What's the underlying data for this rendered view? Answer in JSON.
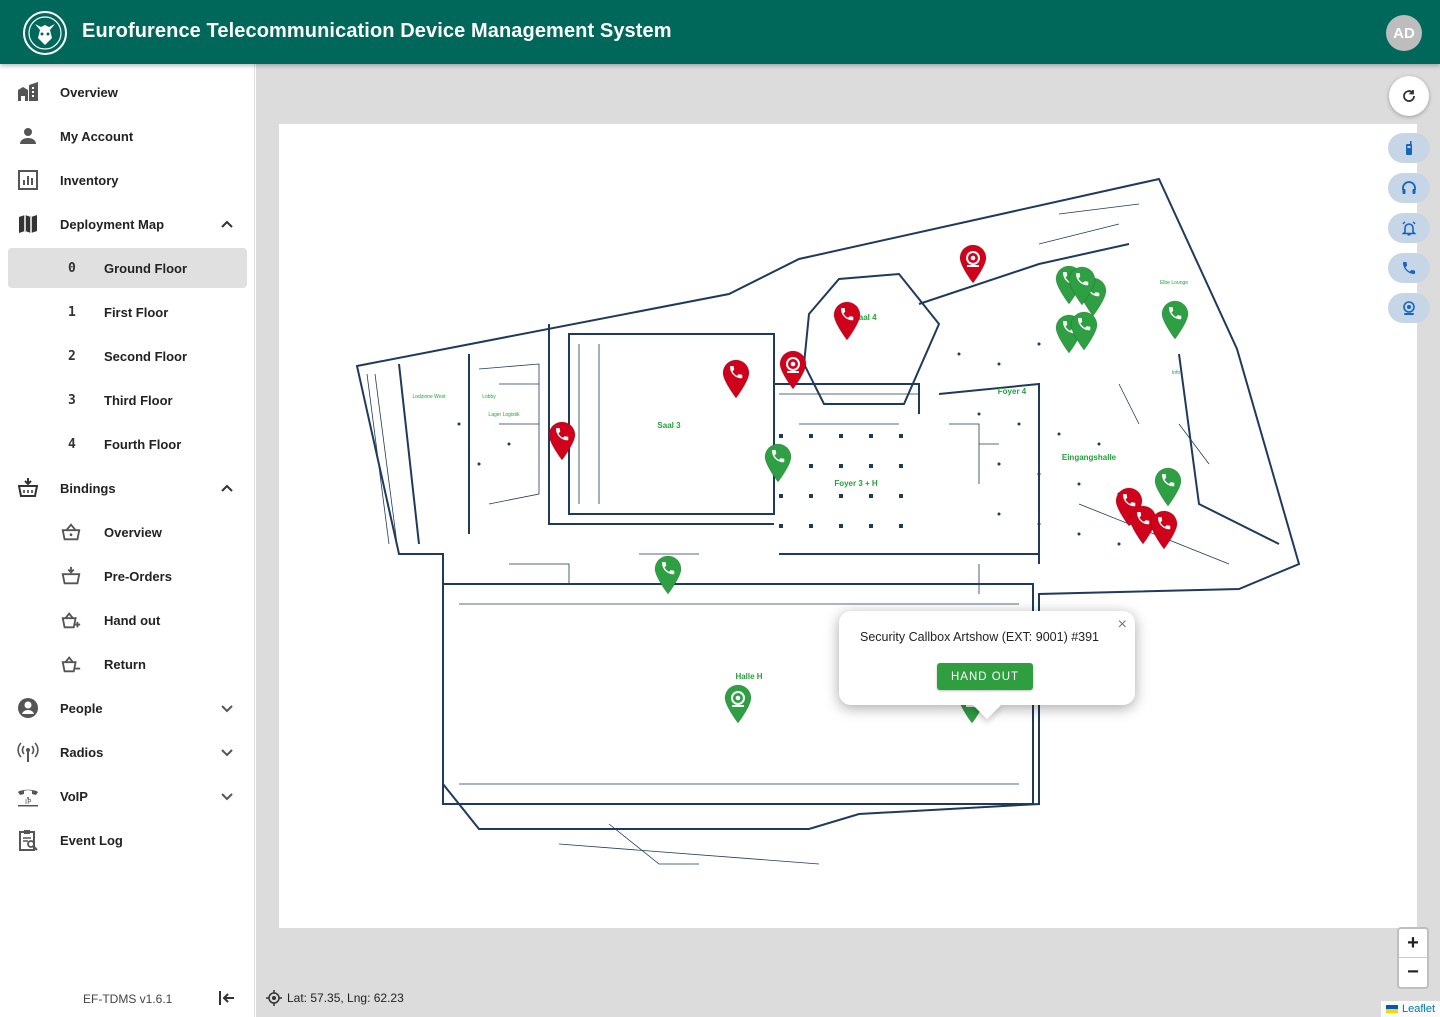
{
  "app": {
    "title": "Eurofurence Telecommunication Device Management System",
    "avatar_initials": "AD",
    "version": "EF-TDMS v1.6.1",
    "brand_color": "#00675b"
  },
  "sidebar": {
    "items": [
      {
        "label": "Overview",
        "icon": "building-icon"
      },
      {
        "label": "My Account",
        "icon": "person-icon"
      },
      {
        "label": "Inventory",
        "icon": "chart-box-icon"
      },
      {
        "label": "Deployment Map",
        "icon": "map-icon",
        "expanded": true
      },
      {
        "label": "Bindings",
        "icon": "basket-icon",
        "expanded": true
      },
      {
        "label": "People",
        "icon": "account-circle-icon",
        "expanded": false
      },
      {
        "label": "Radios",
        "icon": "radio-tower-icon",
        "expanded": false
      },
      {
        "label": "VoIP",
        "icon": "ip-phone-icon",
        "expanded": false
      },
      {
        "label": "Event Log",
        "icon": "clipboard-search-icon"
      }
    ],
    "floors": [
      {
        "num": "0",
        "label": "Ground Floor",
        "active": true
      },
      {
        "num": "1",
        "label": "First Floor"
      },
      {
        "num": "2",
        "label": "Second Floor"
      },
      {
        "num": "3",
        "label": "Third Floor"
      },
      {
        "num": "4",
        "label": "Fourth Floor"
      }
    ],
    "bindings": [
      {
        "label": "Overview",
        "icon": "basket-icon"
      },
      {
        "label": "Pre-Orders",
        "icon": "basket-down-icon"
      },
      {
        "label": "Hand out",
        "icon": "basket-plus-icon"
      },
      {
        "label": "Return",
        "icon": "basket-minus-icon"
      }
    ]
  },
  "map": {
    "status_colors": {
      "available": "#2ea043",
      "handed_out": "#d0021b"
    },
    "room_labels": [
      "Saal 4",
      "Foyer 4",
      "Saal 3",
      "Foyer 3 + H",
      "Eingangshalle",
      "Halle H",
      "Lobby",
      "Lager Logistik",
      "Lodzione West",
      "Elbe Lounge",
      "Info"
    ],
    "markers": [
      {
        "type": "phone",
        "status": "handed_out"
      },
      {
        "type": "phone",
        "status": "handed_out"
      },
      {
        "type": "camera",
        "status": "handed_out"
      },
      {
        "type": "phone",
        "status": "handed_out"
      },
      {
        "type": "camera",
        "status": "handed_out"
      },
      {
        "type": "phone",
        "status": "available"
      },
      {
        "type": "phone",
        "status": "available"
      },
      {
        "type": "phone",
        "status": "available"
      },
      {
        "type": "phone",
        "status": "available"
      },
      {
        "type": "phone",
        "status": "available"
      },
      {
        "type": "phone",
        "status": "available"
      },
      {
        "type": "phone",
        "status": "available"
      },
      {
        "type": "phone",
        "status": "available"
      },
      {
        "type": "phone",
        "status": "handed_out"
      },
      {
        "type": "phone",
        "status": "handed_out"
      },
      {
        "type": "phone",
        "status": "handed_out"
      },
      {
        "type": "phone",
        "status": "available"
      },
      {
        "type": "camera",
        "status": "available"
      },
      {
        "type": "camera",
        "status": "available"
      }
    ],
    "popup": {
      "text": "Security Callbox Artshow (EXT: 9001) #391",
      "button": "HAND OUT",
      "close": "×"
    },
    "coords_text": "Lat: 57.35, Lng: 62.23",
    "zoom_in": "+",
    "zoom_out": "−",
    "attribution": "Leaflet",
    "filter_buttons": [
      "radio-icon",
      "headset-icon",
      "alarm-icon",
      "phone-icon",
      "camera-icon"
    ]
  }
}
